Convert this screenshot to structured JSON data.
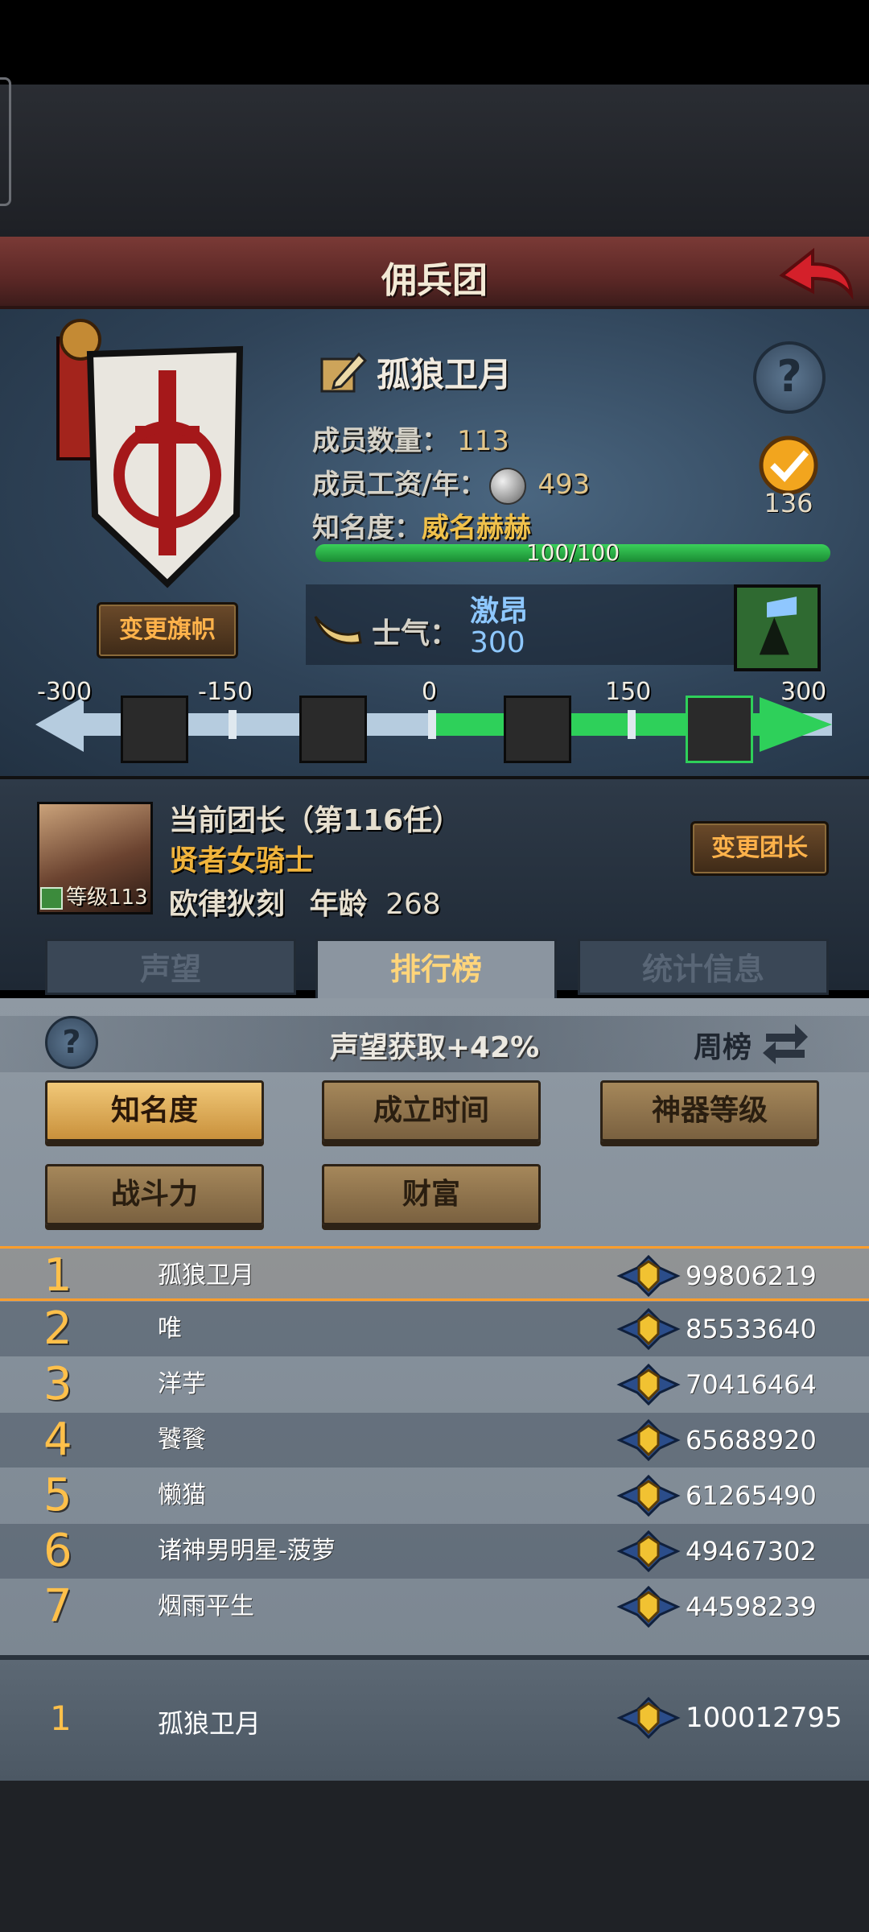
{
  "title": "佣兵团",
  "guild": {
    "name": "孤狼卫月",
    "change_flag_label": "变更旗帜",
    "members_label": "成员数量：",
    "members_value": "113",
    "salary_label": "成员工资/年：",
    "salary_value": "493",
    "fame_label": "知名度：",
    "fame_value": "威名赫赫",
    "fame_progress_text": "100/100",
    "fame_progress": 1.0,
    "badge_count": "136",
    "morale_label": "士气：",
    "morale_state": "激昂",
    "morale_value": "300"
  },
  "morale_scale": {
    "ticks": [
      "-300",
      "-150",
      "0",
      "150",
      "300"
    ],
    "current": 300,
    "min": -300,
    "max": 300
  },
  "leader": {
    "title": "当前团长（第116任）",
    "name": "贤者女骑士",
    "traits": "欧律狄刻",
    "age_label": "年龄",
    "age_value": "268",
    "level_label": "等级113",
    "change_leader_label": "变更团长"
  },
  "tabs": [
    {
      "label": "声望",
      "active": false
    },
    {
      "label": "排行榜",
      "active": true
    },
    {
      "label": "统计信息",
      "active": false
    }
  ],
  "ranking": {
    "bonus_text": "声望获取+42%",
    "period_label": "周榜",
    "filters": [
      "知名度",
      "成立时间",
      "神器等级",
      "战斗力",
      "财富"
    ],
    "active_filter": "知名度",
    "rows": [
      {
        "rank": "1",
        "name": "孤狼卫月",
        "score": "99806219"
      },
      {
        "rank": "2",
        "name": "唯",
        "score": "85533640"
      },
      {
        "rank": "3",
        "name": "洋芋",
        "score": "70416464"
      },
      {
        "rank": "4",
        "name": "饕餮",
        "score": "65688920"
      },
      {
        "rank": "5",
        "name": "懒猫",
        "score": "61265490"
      },
      {
        "rank": "6",
        "name": "诸神男明星-菠萝",
        "score": "49467302"
      },
      {
        "rank": "7",
        "name": "烟雨平生",
        "score": "44598239"
      }
    ],
    "self": {
      "rank": "1",
      "name": "孤狼卫月",
      "score": "100012795"
    }
  },
  "colors": {
    "accent_gold": "#ffc04a",
    "morale_blue": "#8ec8ff",
    "fame_green": "#2ed05a",
    "highlight_orange": "#ff9e2c"
  }
}
